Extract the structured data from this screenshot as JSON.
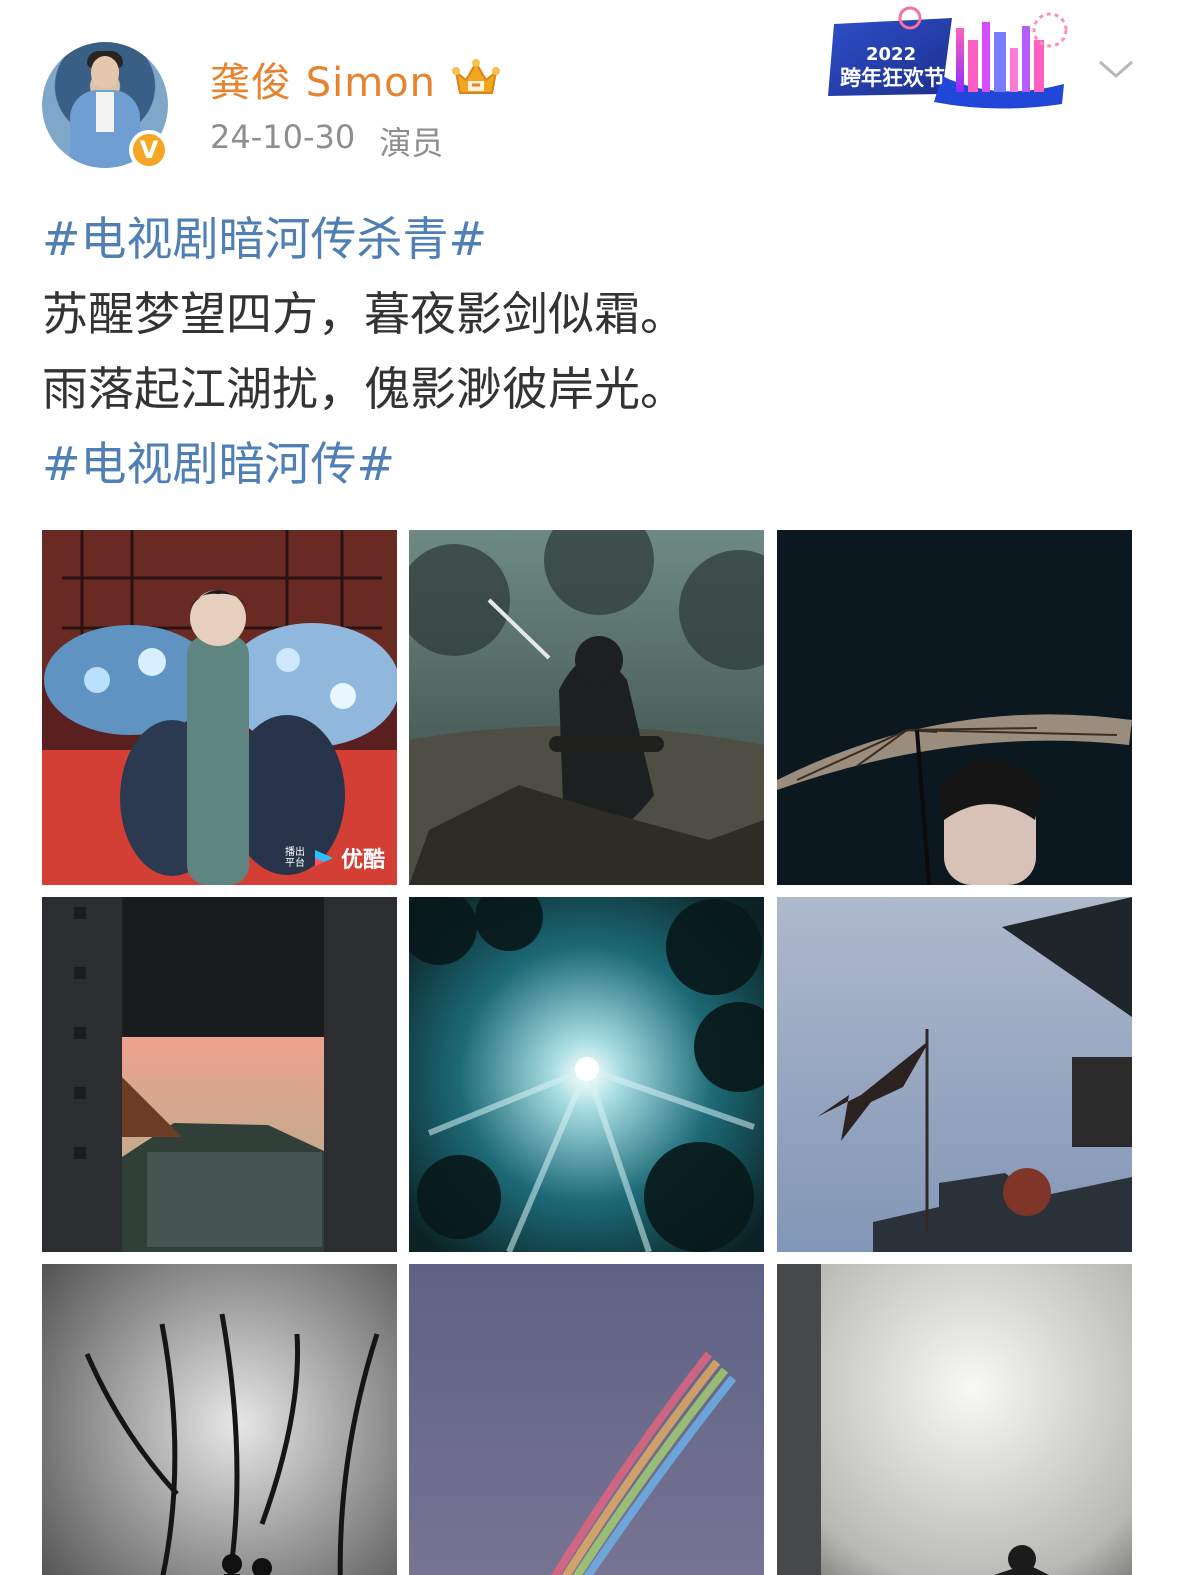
{
  "user": {
    "name": "龚俊 Simon",
    "date": "24-10-30",
    "role": "演员",
    "verified_mark": "V",
    "accent": "#e7822f"
  },
  "banner": {
    "year": "2022",
    "title": "跨年狂欢节"
  },
  "post": {
    "hashtag_top": "#电视剧暗河传杀青#",
    "line1": "苏醒梦望四方，暮夜影剑似霜。",
    "line2": "雨落起江湖扰，傀影渺彼岸光。",
    "hashtag_bottom": "#电视剧暗河传#",
    "hashtag_color": "#4f7fb4"
  },
  "photos": [
    {
      "scene": "actor-holding-blue-bouquets",
      "watermark_label": "播出平台",
      "watermark_brand": "优酷"
    },
    {
      "scene": "swordsman-in-misty-forest"
    },
    {
      "scene": "paper-umbrella-portrait"
    },
    {
      "scene": "sunset-through-gateway"
    },
    {
      "scene": "sunlight-through-trees"
    },
    {
      "scene": "tattered-flag-and-rooftop"
    },
    {
      "scene": "misty-black-white-trees"
    },
    {
      "scene": "rainbow-in-dusk-sky"
    },
    {
      "scene": "hazy-light-silhouette"
    }
  ],
  "icons": {
    "dropdown": "chevron-down-icon",
    "crown": "crown-icon",
    "verified": "verified-badge-icon"
  }
}
